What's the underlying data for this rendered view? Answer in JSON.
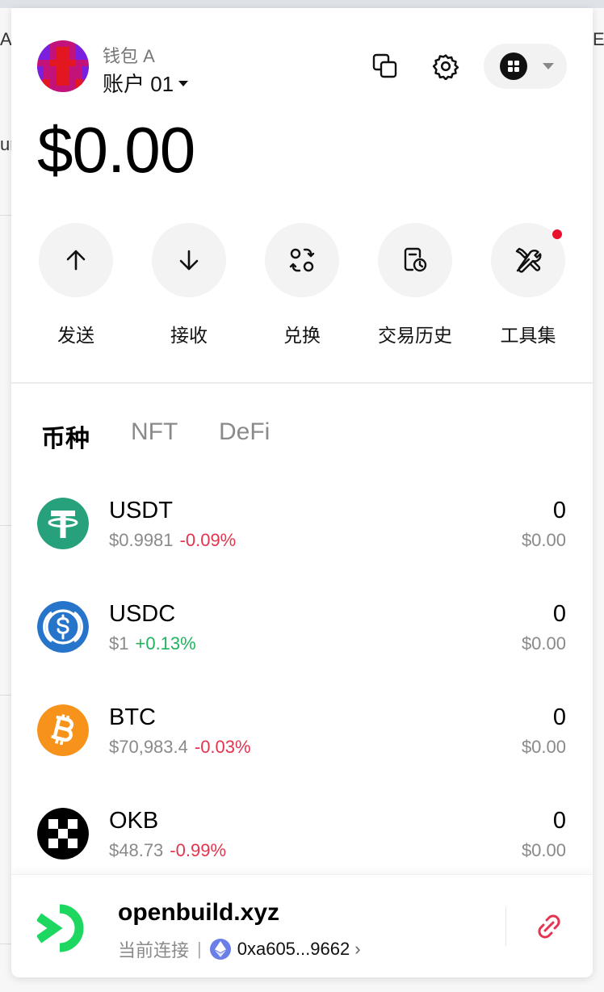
{
  "background": {
    "text_top": "AS",
    "text_top_right": "E",
    "text_mid": "ur"
  },
  "header": {
    "wallet_name": "钱包 A",
    "account_name": "账户 01",
    "icons": [
      "copy-icon",
      "gear-icon",
      "apps-grid-icon",
      "chevron-down-icon"
    ]
  },
  "balance": "$0.00",
  "actions": [
    {
      "label": "发送",
      "icon": "arrow-up-icon"
    },
    {
      "label": "接收",
      "icon": "arrow-down-icon"
    },
    {
      "label": "兑换",
      "icon": "swap-icon"
    },
    {
      "label": "交易历史",
      "icon": "history-icon"
    },
    {
      "label": "工具集",
      "icon": "tools-icon",
      "badge": true
    }
  ],
  "tabs": [
    {
      "label": "币种",
      "active": true
    },
    {
      "label": "NFT",
      "active": false
    },
    {
      "label": "DeFi",
      "active": false
    }
  ],
  "tokens": [
    {
      "symbol": "USDT",
      "price": "$0.9981",
      "change": "-0.09%",
      "amount": "0",
      "value": "$0.00",
      "color": "#26a17b"
    },
    {
      "symbol": "USDC",
      "price": "$1",
      "change": "+0.13%",
      "amount": "0",
      "value": "$0.00",
      "color": "#2775ca"
    },
    {
      "symbol": "BTC",
      "price": "$70,983.4",
      "change": "-0.03%",
      "amount": "0",
      "value": "$0.00",
      "color": "#f7931a"
    },
    {
      "symbol": "OKB",
      "price": "$48.73",
      "change": "-0.99%",
      "amount": "0",
      "value": "$0.00",
      "color": "#000000"
    }
  ],
  "footer": {
    "site_name": "openbuild.xyz",
    "status": "当前连接",
    "separator": "|",
    "address": "0xa605...9662",
    "chevron": "›"
  },
  "colors": {
    "negative": "#e4344f",
    "positive": "#22b35e",
    "badge": "#e8102a",
    "openbuild_green": "#1ed760",
    "disconnect_red": "#e4344f"
  }
}
